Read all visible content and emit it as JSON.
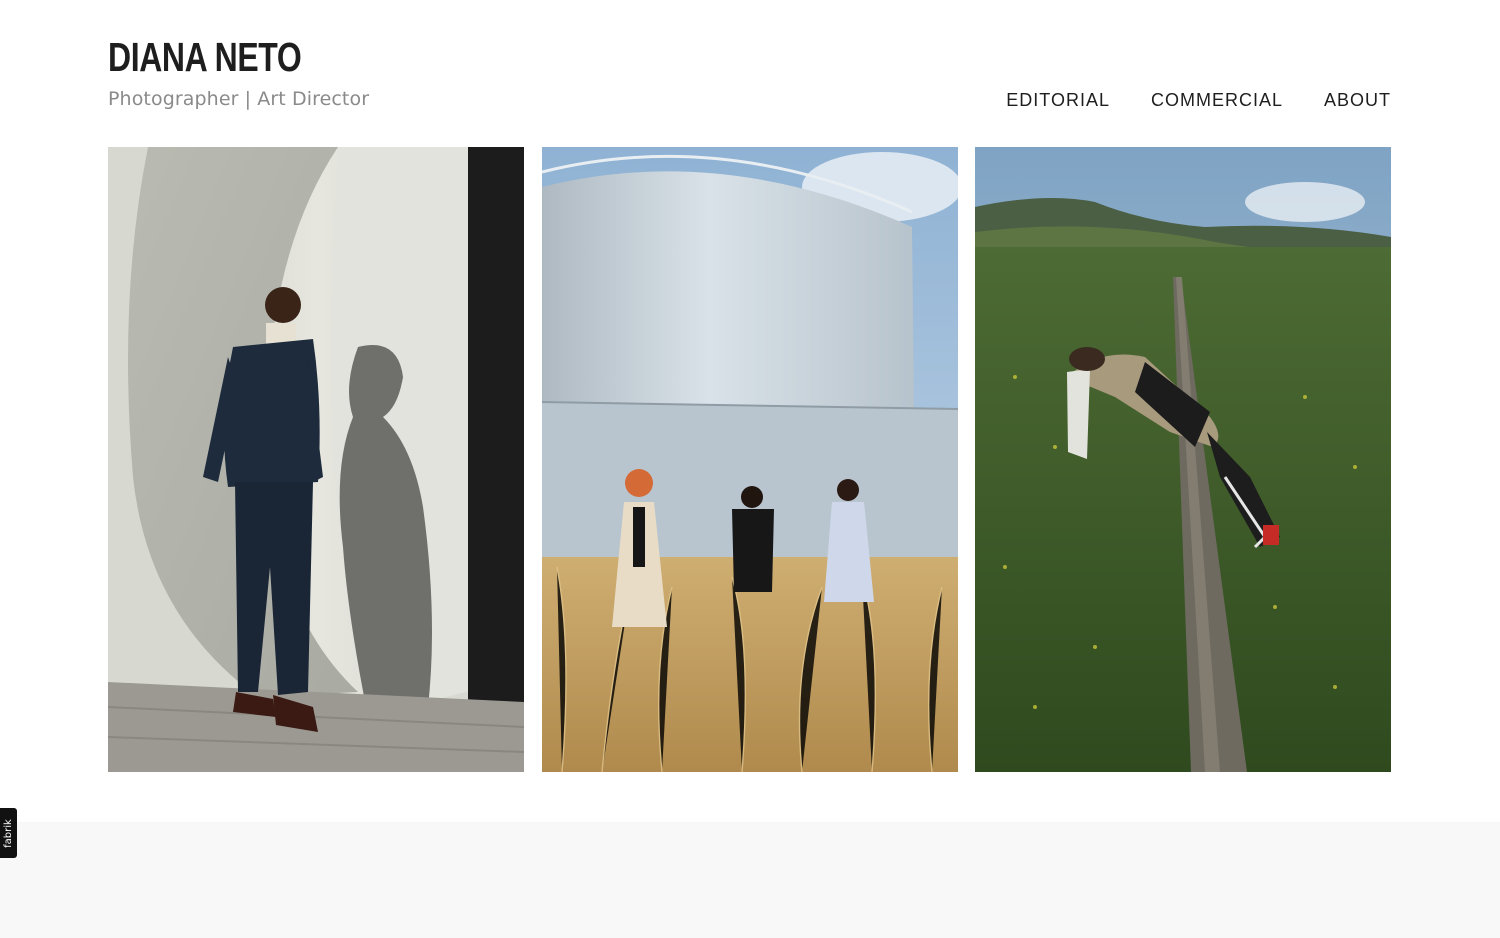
{
  "header": {
    "title": "DIANA NETO",
    "subtitle": "Photographer | Art Director"
  },
  "nav": {
    "items": [
      {
        "label": "EDITORIAL"
      },
      {
        "label": "COMMERCIAL"
      },
      {
        "label": "ABOUT"
      }
    ]
  },
  "gallery": {
    "photos": [
      {
        "subject": "man-in-navy-suit-against-white-curved-wall"
      },
      {
        "subject": "three-models-in-tall-grass-before-white-tank"
      },
      {
        "subject": "model-reclining-on-wooden-fence-in-green-field"
      }
    ]
  },
  "badge": {
    "label": "fabrik"
  },
  "colors": {
    "background": "#ffffff",
    "footer_background": "#f8f8f8",
    "title_text": "#1e1e1e",
    "subtitle_text": "#8a8a8a"
  }
}
